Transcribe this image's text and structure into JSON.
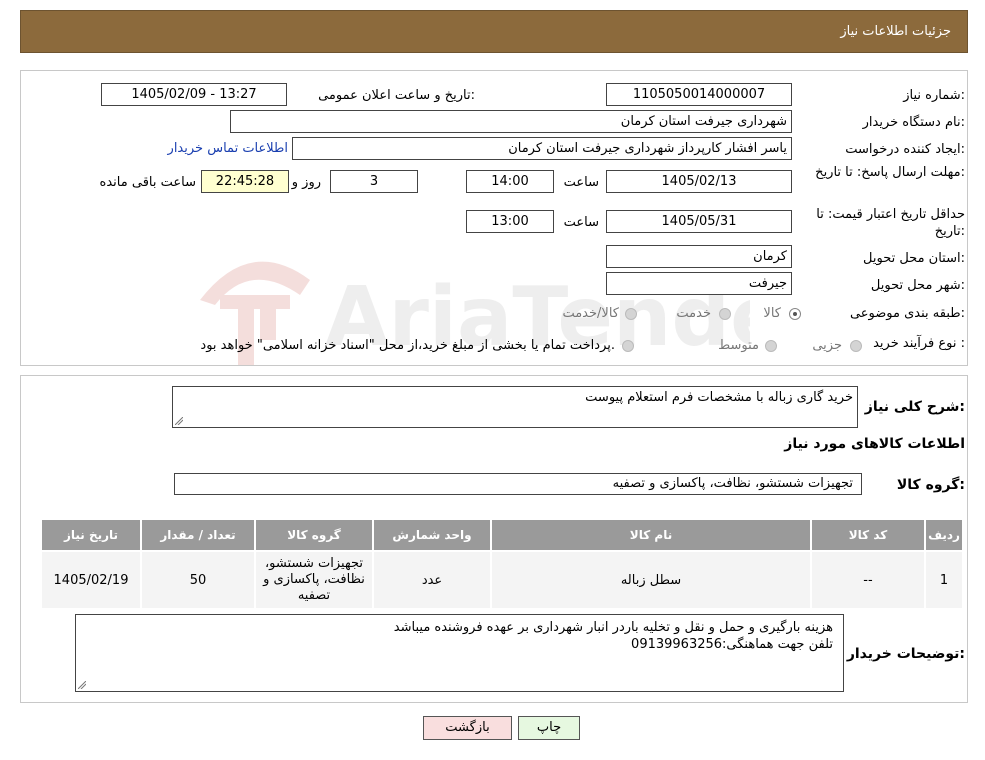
{
  "header": {
    "title": "جزئیات اطلاعات نیاز"
  },
  "form": {
    "need_number_label": "شماره نیاز:",
    "need_number": "1105050014000007",
    "announce_label": "تاریخ و ساعت اعلان عمومی:",
    "announce_value": "1405/02/09 - 13:27",
    "buyer_org_label": "نام دستگاه خریدار:",
    "buyer_org": "شهرداری جیرفت استان کرمان",
    "creator_label": "ایجاد کننده درخواست:",
    "creator": "یاسر افشار کارپرداز شهرداری جیرفت استان کرمان",
    "contact_link": "اطلاعات تماس خریدار",
    "reply_deadline_label": "مهلت ارسال پاسخ: تا تاریخ:",
    "reply_date": "1405/02/13",
    "time_label": "ساعت",
    "reply_time": "14:00",
    "days_value": "3",
    "days_label": "روز و",
    "remaining_time": "22:45:28",
    "remaining_label": "ساعت باقی مانده",
    "validity_label": "حداقل تاریخ اعتبار قیمت: تا تاریخ:",
    "validity_date": "1405/05/31",
    "validity_time": "13:00",
    "province_label": "استان محل تحویل:",
    "province": "کرمان",
    "city_label": "شهر محل تحویل:",
    "city": "جیرفت",
    "category_label": "طبقه بندی موضوعی:",
    "category_options": [
      "کالا",
      "خدمت",
      "کالا/خدمت"
    ],
    "process_label": "نوع فرآیند خرید :",
    "process_options": [
      "جزیی",
      "متوسط"
    ],
    "process_note": "پرداخت تمام یا بخشی از مبلغ خرید،از محل \"اسناد خزانه اسلامی\" خواهد بود."
  },
  "details": {
    "summary_label": "شرح کلی نیاز:",
    "summary": "خرید گاری زباله با مشخصات فرم استعلام پیوست",
    "goods_title": "اطلاعات کالاهای مورد نیاز",
    "group_label": "گروه کالا:",
    "group_value": "تجهیزات شستشو، نظافت، پاکسازی و تصفیه",
    "table": {
      "headers": [
        "ردیف",
        "کد کالا",
        "نام کالا",
        "واحد شمارش",
        "گروه کالا",
        "تعداد / مقدار",
        "تاریخ نیاز"
      ],
      "rows": [
        [
          "1",
          "--",
          "سطل زباله",
          "عدد",
          "تجهیزات شستشو، نظافت، پاکسازی و تصفیه",
          "50",
          "1405/02/19"
        ]
      ]
    },
    "buyer_notes_label": "توضیحات خریدار:",
    "buyer_notes_line1": "هزینه بارگیری و حمل و نقل و تخلیه باردر انبار شهرداری بر عهده فروشنده میباشد",
    "buyer_notes_line2": "تلفن جهت هماهنگی:09139963256"
  },
  "buttons": {
    "print": "چاپ",
    "back": "بازگشت"
  },
  "watermark": {
    "text": "AriaTender.neT"
  },
  "colors": {
    "header": "#8c6a3c",
    "back_button": "#f9dede",
    "print_button": "#e6f8e0",
    "remaining_bg": "#ffffd0"
  }
}
